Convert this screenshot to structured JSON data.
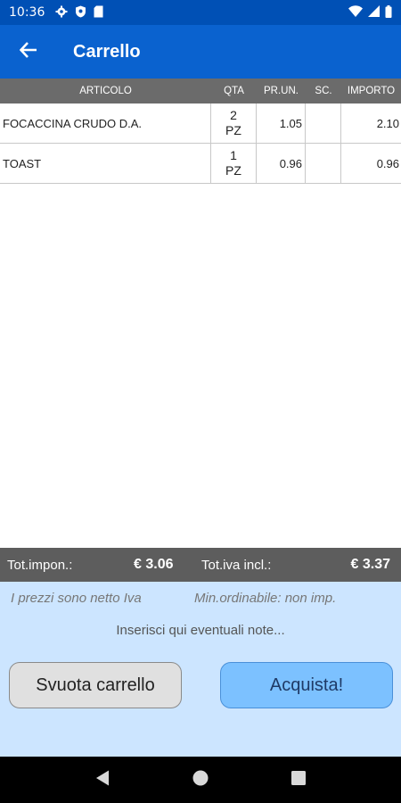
{
  "status_bar": {
    "time": "10:36"
  },
  "app_bar": {
    "title": "Carrello"
  },
  "table": {
    "headers": {
      "articolo": "ARTICOLO",
      "qta": "QTA",
      "pr_un": "PR.UN.",
      "sc": "SC.",
      "importo": "IMPORTO"
    },
    "rows": [
      {
        "articolo": "FOCACCINA CRUDO D.A.",
        "qta": "2",
        "um": "PZ",
        "pr_un": "1.05",
        "sc": "",
        "importo": "2.10"
      },
      {
        "articolo": "TOAST",
        "qta": "1",
        "um": "PZ",
        "pr_un": "0.96",
        "sc": "",
        "importo": "0.96"
      }
    ]
  },
  "totals": {
    "imponibile_label": "Tot.impon.:",
    "imponibile_value": "€  3.06",
    "iva_label": "Tot.iva incl.:",
    "iva_value": "€  3.37"
  },
  "info": {
    "prezzi_netto": "I prezzi sono netto Iva",
    "min_ordinabile": "Min.ordinabile: non imp."
  },
  "notes": {
    "placeholder": "Inserisci qui eventuali note..."
  },
  "buttons": {
    "svuota": "Svuota carrello",
    "acquista": "Acquista!"
  }
}
